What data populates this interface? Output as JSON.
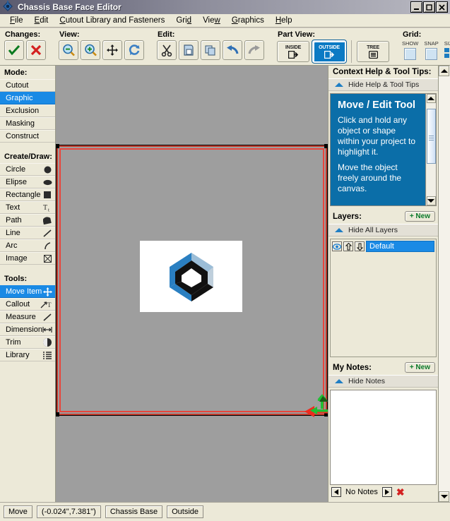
{
  "window": {
    "title": "Chassis Base Face Editor",
    "icon": "app-diamond-icon",
    "buttons": {
      "minimize": "_",
      "maximize": "□",
      "close": "×"
    }
  },
  "menu": [
    {
      "label": "File",
      "accel": "F"
    },
    {
      "label": "Edit",
      "accel": "E"
    },
    {
      "label": "Cutout Library and Fasteners",
      "accel": "C"
    },
    {
      "label": "Grid",
      "accel": "d"
    },
    {
      "label": "View",
      "accel": "w"
    },
    {
      "label": "Graphics",
      "accel": "G"
    },
    {
      "label": "Help",
      "accel": "H"
    }
  ],
  "toolbar": {
    "groups": [
      {
        "label": "Changes:",
        "buttons": [
          {
            "name": "accept-changes-button",
            "icon": "check-icon"
          },
          {
            "name": "reject-changes-button",
            "icon": "cross-icon"
          }
        ]
      },
      {
        "label": "View:",
        "buttons": [
          {
            "name": "zoom-out-button",
            "icon": "zoom-out-icon"
          },
          {
            "name": "zoom-in-button",
            "icon": "zoom-in-icon"
          },
          {
            "name": "pan-button",
            "icon": "move-arrows-icon"
          },
          {
            "name": "refresh-button",
            "icon": "refresh-icon"
          }
        ]
      },
      {
        "label": "Edit:",
        "buttons": [
          {
            "name": "cut-button",
            "icon": "scissors-icon"
          },
          {
            "name": "paste-button",
            "icon": "paste-icon"
          },
          {
            "name": "copy-button",
            "icon": "copy-icon"
          },
          {
            "name": "undo-button",
            "icon": "undo-arrow-icon"
          },
          {
            "name": "redo-button",
            "icon": "redo-arrow-icon"
          }
        ]
      }
    ],
    "part_view": {
      "label": "Part View:",
      "inside_label": "INSIDE",
      "outside_label": "OUTSIDE",
      "tree_label": "TREE",
      "selected": "OUTSIDE"
    },
    "grid": {
      "label": "Grid:",
      "show_label": "SHOW",
      "snap_label": "SNAP",
      "size_label": "SIZE",
      "show_checked": false,
      "snap_checked": false
    }
  },
  "sidebar": {
    "mode_title": "Mode:",
    "modes": [
      {
        "label": "Cutout",
        "selected": false
      },
      {
        "label": "Graphic",
        "selected": true
      },
      {
        "label": "Exclusion",
        "selected": false
      },
      {
        "label": "Masking",
        "selected": false
      },
      {
        "label": "Construct",
        "selected": false
      }
    ],
    "create_title": "Create/Draw:",
    "create": [
      {
        "label": "Circle",
        "icon": "circle-icon"
      },
      {
        "label": "Elipse",
        "icon": "ellipse-icon"
      },
      {
        "label": "Rectangle",
        "icon": "square-icon"
      },
      {
        "label": "Text",
        "icon": "text-t-icon"
      },
      {
        "label": "Path",
        "icon": "path-icon"
      },
      {
        "label": "Line",
        "icon": "line-icon"
      },
      {
        "label": "Arc",
        "icon": "arc-icon"
      },
      {
        "label": "Image",
        "icon": "image-icon"
      }
    ],
    "tools_title": "Tools:",
    "tools": [
      {
        "label": "Move Item",
        "icon": "move-item-icon",
        "selected": true
      },
      {
        "label": "Callout",
        "icon": "callout-icon",
        "selected": false
      },
      {
        "label": "Measure",
        "icon": "measure-icon",
        "selected": false
      },
      {
        "label": "Dimension",
        "icon": "dimension-icon",
        "selected": false
      },
      {
        "label": "Trim",
        "icon": "trim-icon",
        "selected": false
      },
      {
        "label": "Library",
        "icon": "library-list-icon",
        "selected": false
      }
    ]
  },
  "help_panel": {
    "title": "Context Help & Tool Tips:",
    "hide_label": "Hide Help & Tool Tips",
    "tip_title": "Move / Edit Tool",
    "tip_paragraph_1": "Click and hold any object or shape within your project to highlight it.",
    "tip_paragraph_2": "Move the object freely around the canvas."
  },
  "layers_panel": {
    "title": "Layers:",
    "new_label": "+ New",
    "hide_label": "Hide All Layers",
    "rows": [
      {
        "name": "Default",
        "visible": true,
        "selected": true
      }
    ]
  },
  "notes_panel": {
    "title": "My Notes:",
    "new_label": "+ New",
    "hide_label": "Hide Notes",
    "note_text": "",
    "status": "No Notes"
  },
  "canvas": {
    "object_name": "image-object",
    "selection_color": "#e8453c",
    "background": "#9e9e9e",
    "drag_arrow_green": "#22c03a",
    "drag_arrow_red": "#ee2b1f"
  },
  "statusbar": {
    "fields": [
      {
        "name": "status-mode",
        "value": "Move"
      },
      {
        "name": "status-coordinates",
        "value": "(-0.024\",7.381\")"
      },
      {
        "name": "status-part",
        "value": "Chassis Base"
      },
      {
        "name": "status-face",
        "value": "Outside"
      }
    ]
  },
  "colors": {
    "accent_blue": "#1a8ae5",
    "panel": "#ece9d8",
    "help_blue": "#0b6ea8",
    "new_green": "#0a7a2a"
  }
}
